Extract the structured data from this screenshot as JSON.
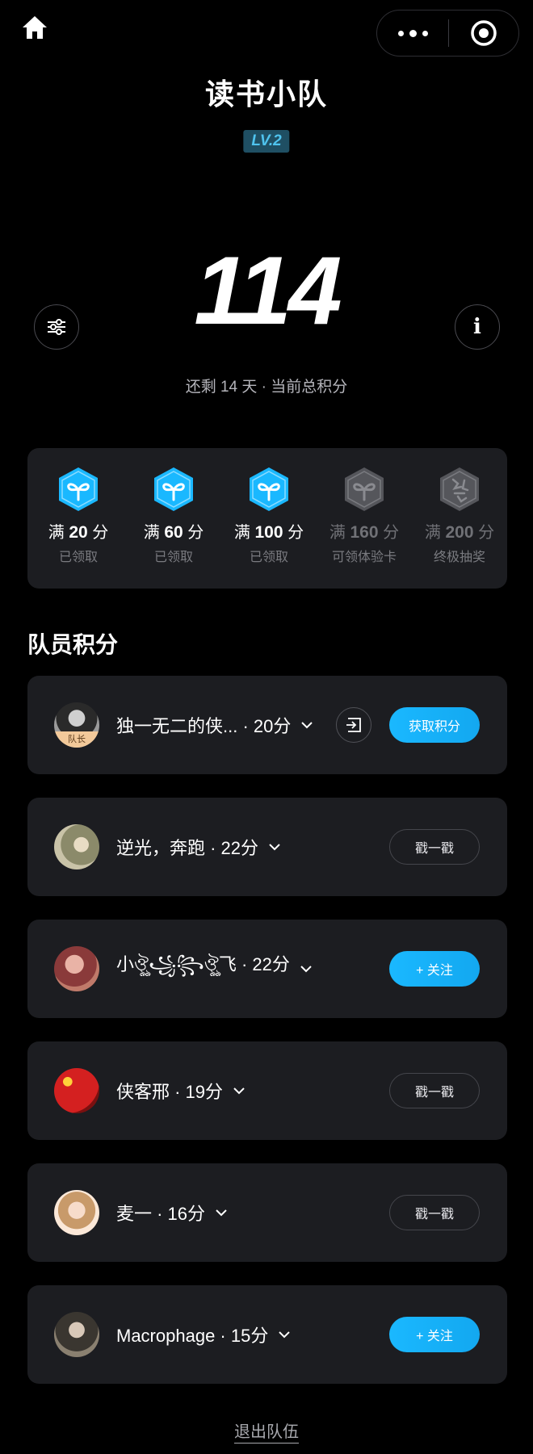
{
  "header": {
    "title": "读书小队",
    "level": "LV.2"
  },
  "score": {
    "value": "114",
    "subtitle": "还剩 14 天 · 当前总积分"
  },
  "rewards": [
    {
      "prefix": "满",
      "points": "20",
      "unit": "分",
      "status": "已领取",
      "state": "claimed"
    },
    {
      "prefix": "满",
      "points": "60",
      "unit": "分",
      "status": "已领取",
      "state": "claimed"
    },
    {
      "prefix": "满",
      "points": "100",
      "unit": "分",
      "status": "已领取",
      "state": "claimed"
    },
    {
      "prefix": "满",
      "points": "160",
      "unit": "分",
      "status": "可领体验卡",
      "state": "locked"
    },
    {
      "prefix": "满",
      "points": "200",
      "unit": "分",
      "status": "终极抽奖",
      "state": "locked"
    }
  ],
  "section_title": "队员积分",
  "members": [
    {
      "name": "独一无二的侠... · 20分",
      "tag": "队长",
      "action": "获取积分",
      "action_style": "primary",
      "has_exit_icon": true
    },
    {
      "name": "逆光，奔跑 · 22分",
      "action": "戳一戳",
      "action_style": "ghost"
    },
    {
      "name": "小ঔৣ꧁꧂ঔৣ飞 · 22分",
      "action": "+ 关注",
      "action_style": "primary"
    },
    {
      "name": "侠客邢 · 19分",
      "action": "戳一戳",
      "action_style": "ghost"
    },
    {
      "name": "麦一 · 16分",
      "action": "戳一戳",
      "action_style": "ghost"
    },
    {
      "name": "Macrophage · 15分",
      "action": "+ 关注",
      "action_style": "primary"
    }
  ],
  "footer": {
    "exit_label": "退出队伍"
  },
  "colors": {
    "accent": "#1ab8ff",
    "card": "#1c1d21",
    "level_bg": "#1f4f63",
    "level_text": "#4fc3ee"
  },
  "icons": [
    "home-icon",
    "more-icon",
    "target-icon",
    "filter-icon",
    "info-icon",
    "reward-hex-icon",
    "exit-icon",
    "chevron-down-icon"
  ]
}
